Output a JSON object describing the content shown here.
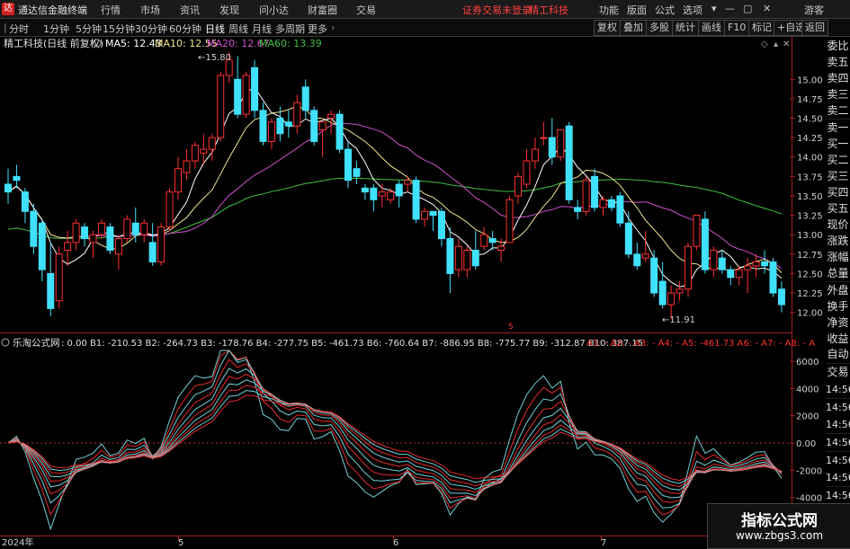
{
  "app": {
    "title": "通达信金融终端"
  },
  "menu": {
    "items": [
      "行情",
      "市场",
      "资讯",
      "发现",
      "问小达",
      "财富圈",
      "交易"
    ],
    "login_status": "证券交易未登录",
    "stock_name": "精工科技",
    "right_items": [
      "功能",
      "版面",
      "公式",
      "选项"
    ],
    "guest": "游客"
  },
  "toolbar": {
    "periods": [
      "分时",
      "1分钟",
      "5分钟",
      "15分钟",
      "30分钟",
      "60分钟",
      "日线",
      "周线",
      "月线",
      "多周期",
      "更多"
    ],
    "active_period": "日线",
    "right_buttons": [
      "复权",
      "叠加",
      "多股",
      "统计",
      "画线",
      "F10",
      "标记",
      "+自选",
      "返回"
    ]
  },
  "main_chart": {
    "title": "精工科技(日线 前复权)",
    "ma": [
      {
        "label": "MA5: 12.43",
        "color": "#ffffff"
      },
      {
        "label": "MA10: 12.55",
        "color": "#f0e68c"
      },
      {
        "label": "MA20: 12.67",
        "color": "#d050d0"
      },
      {
        "label": "MA60: 13.39",
        "color": "#40c040"
      }
    ],
    "high_marker": "15.80",
    "low_marker": "11.91",
    "y_labels": [
      "15.00",
      "14.75",
      "14.50",
      "14.25",
      "14.00",
      "13.75",
      "13.50",
      "13.25",
      "13.00",
      "12.75",
      "12.50",
      "12.25",
      "12.00"
    ]
  },
  "indicator": {
    "name": "乐淘公式网",
    "values": ": 0.00  B1: -210.53  B2: -264.73  B3: -178.76  B4: -277.75  B5: -461.73  B6: -760.64  B7: -886.95  B8: -775.77  B9: -312.87  B10: 387.15",
    "values_red": "A1: -  A2: -  A3: -  A4: -  A5: -461.73  A6: -  A7: -  A8: -  A",
    "y_labels": [
      "6000",
      "4000",
      "2000",
      "0.00",
      "-2000",
      "-4000",
      "-6000"
    ]
  },
  "x_axis": {
    "labels": [
      "2024年",
      "5",
      "6",
      "7"
    ]
  },
  "side_panel": {
    "items": [
      "委比",
      "卖五",
      "卖四",
      "卖三",
      "卖二",
      "卖一",
      "买一",
      "买二",
      "买三",
      "买四",
      "买五",
      "现价",
      "涨跌",
      "涨幅",
      "总量",
      "外盘",
      "换手",
      "净资",
      "收益"
    ],
    "lower_items": [
      "自动",
      "交易",
      "14:56",
      "14:56",
      "14:56",
      "14:56",
      "14:56",
      "14:56",
      "14:56",
      "14:56",
      "14:56"
    ]
  },
  "watermark": {
    "line1": "指标公式网",
    "line2": "www.zbgs3.com"
  },
  "colors": {
    "up": "#ff3030",
    "down": "#40e0ff",
    "ma5": "#ffffff",
    "ma10": "#f0e68c",
    "ma20": "#d050d0",
    "ma60": "#40c040"
  },
  "chart_data": {
    "type": "candlestick",
    "ylim": [
      11.8,
      15.35
    ],
    "dates": [
      "2024年",
      "5",
      "6",
      "7"
    ],
    "candles": [
      [
        13.65,
        13.85,
        13.4,
        13.55
      ],
      [
        13.75,
        13.9,
        13.6,
        13.7
      ],
      [
        13.55,
        13.6,
        13.15,
        13.3
      ],
      [
        13.3,
        13.4,
        12.75,
        12.85
      ],
      [
        13.15,
        13.2,
        12.4,
        12.55
      ],
      [
        12.5,
        12.9,
        11.95,
        12.05
      ],
      [
        12.15,
        12.85,
        12.05,
        12.75
      ],
      [
        12.8,
        13.05,
        12.6,
        12.9
      ],
      [
        12.9,
        13.2,
        12.8,
        13.15
      ],
      [
        13.1,
        13.15,
        12.85,
        12.95
      ],
      [
        12.9,
        13.05,
        12.7,
        13.0
      ],
      [
        13.0,
        13.2,
        12.95,
        13.15
      ],
      [
        13.1,
        13.15,
        12.75,
        12.8
      ],
      [
        12.75,
        13.0,
        12.55,
        12.95
      ],
      [
        12.95,
        13.25,
        12.9,
        13.2
      ],
      [
        13.15,
        13.35,
        12.9,
        13.0
      ],
      [
        13.0,
        13.2,
        12.9,
        13.15
      ],
      [
        12.9,
        13.15,
        12.6,
        12.65
      ],
      [
        12.65,
        13.15,
        12.6,
        13.1
      ],
      [
        13.1,
        13.6,
        13.05,
        13.55
      ],
      [
        13.55,
        14.0,
        13.45,
        13.85
      ],
      [
        13.8,
        14.1,
        13.7,
        13.95
      ],
      [
        13.95,
        14.2,
        13.85,
        14.15
      ],
      [
        14.05,
        14.3,
        13.9,
        14.1
      ],
      [
        14.1,
        14.3,
        13.95,
        14.25
      ],
      [
        14.25,
        15.1,
        14.2,
        15.05
      ],
      [
        15.05,
        15.35,
        14.95,
        15.25
      ],
      [
        15.0,
        15.3,
        14.5,
        14.55
      ],
      [
        14.55,
        15.1,
        14.5,
        15.05
      ],
      [
        15.15,
        15.25,
        14.5,
        14.6
      ],
      [
        14.6,
        14.7,
        14.15,
        14.2
      ],
      [
        14.2,
        14.5,
        14.1,
        14.45
      ],
      [
        14.5,
        14.65,
        14.2,
        14.3
      ],
      [
        14.45,
        14.6,
        14.25,
        14.4
      ],
      [
        14.4,
        14.8,
        14.3,
        14.7
      ],
      [
        14.9,
        15.0,
        14.5,
        14.6
      ],
      [
        14.6,
        14.65,
        14.15,
        14.2
      ],
      [
        14.35,
        14.45,
        14.0,
        14.45
      ],
      [
        14.5,
        14.6,
        14.3,
        14.55
      ],
      [
        14.55,
        14.6,
        14.05,
        14.1
      ],
      [
        14.1,
        14.2,
        13.6,
        13.7
      ],
      [
        13.85,
        13.95,
        13.65,
        13.75
      ],
      [
        13.6,
        13.65,
        13.45,
        13.55
      ],
      [
        13.6,
        13.65,
        13.3,
        13.45
      ],
      [
        13.5,
        13.65,
        13.35,
        13.55
      ],
      [
        13.45,
        13.6,
        13.4,
        13.55
      ],
      [
        13.65,
        13.7,
        13.35,
        13.5
      ],
      [
        13.65,
        13.75,
        13.55,
        13.7
      ],
      [
        13.7,
        13.75,
        13.15,
        13.2
      ],
      [
        13.2,
        13.35,
        13.1,
        13.3
      ],
      [
        13.3,
        13.3,
        13.05,
        13.25
      ],
      [
        13.3,
        13.35,
        12.85,
        12.95
      ],
      [
        12.95,
        13.1,
        12.25,
        12.5
      ],
      [
        12.55,
        12.95,
        12.45,
        12.85
      ],
      [
        12.55,
        12.85,
        12.45,
        12.8
      ],
      [
        12.8,
        13.05,
        12.55,
        12.6
      ],
      [
        12.85,
        13.1,
        12.8,
        13.0
      ],
      [
        12.95,
        13.05,
        12.8,
        12.9
      ],
      [
        12.8,
        12.95,
        12.65,
        12.85
      ],
      [
        12.9,
        13.5,
        12.9,
        13.45
      ],
      [
        13.5,
        13.8,
        13.4,
        13.75
      ],
      [
        13.65,
        14.1,
        13.6,
        13.95
      ],
      [
        13.95,
        14.25,
        13.85,
        14.1
      ],
      [
        14.25,
        14.45,
        14.15,
        14.25
      ],
      [
        14.25,
        14.5,
        13.9,
        14.0
      ],
      [
        14.0,
        14.35,
        13.95,
        14.35
      ],
      [
        14.4,
        14.45,
        13.4,
        13.45
      ],
      [
        13.35,
        13.45,
        13.2,
        13.3
      ],
      [
        13.3,
        13.75,
        13.25,
        13.7
      ],
      [
        13.75,
        13.85,
        13.3,
        13.35
      ],
      [
        13.35,
        13.5,
        13.25,
        13.45
      ],
      [
        13.45,
        13.5,
        13.3,
        13.35
      ],
      [
        13.5,
        13.55,
        13.1,
        13.15
      ],
      [
        13.15,
        13.3,
        12.7,
        12.75
      ],
      [
        12.75,
        12.9,
        12.55,
        12.6
      ],
      [
        12.7,
        13.05,
        12.65,
        12.75
      ],
      [
        12.7,
        12.8,
        12.2,
        12.25
      ],
      [
        12.4,
        12.65,
        12.05,
        12.1
      ],
      [
        12.1,
        12.35,
        11.91,
        12.25
      ],
      [
        12.25,
        12.4,
        12.15,
        12.3
      ],
      [
        12.3,
        12.9,
        12.2,
        12.85
      ],
      [
        12.85,
        13.25,
        12.8,
        13.25
      ],
      [
        13.2,
        13.3,
        12.5,
        12.55
      ],
      [
        12.55,
        12.85,
        12.45,
        12.8
      ],
      [
        12.7,
        12.8,
        12.5,
        12.55
      ],
      [
        12.55,
        12.6,
        12.35,
        12.45
      ],
      [
        12.45,
        12.6,
        12.35,
        12.55
      ],
      [
        12.55,
        12.7,
        12.25,
        12.6
      ],
      [
        12.6,
        12.75,
        12.45,
        12.65
      ],
      [
        12.65,
        12.8,
        12.5,
        12.6
      ],
      [
        12.65,
        12.7,
        12.2,
        12.25
      ],
      [
        12.3,
        12.4,
        12.0,
        12.1
      ]
    ],
    "series": [
      {
        "name": "MA5"
      },
      {
        "name": "MA10"
      },
      {
        "name": "MA20"
      },
      {
        "name": "MA60"
      }
    ]
  }
}
